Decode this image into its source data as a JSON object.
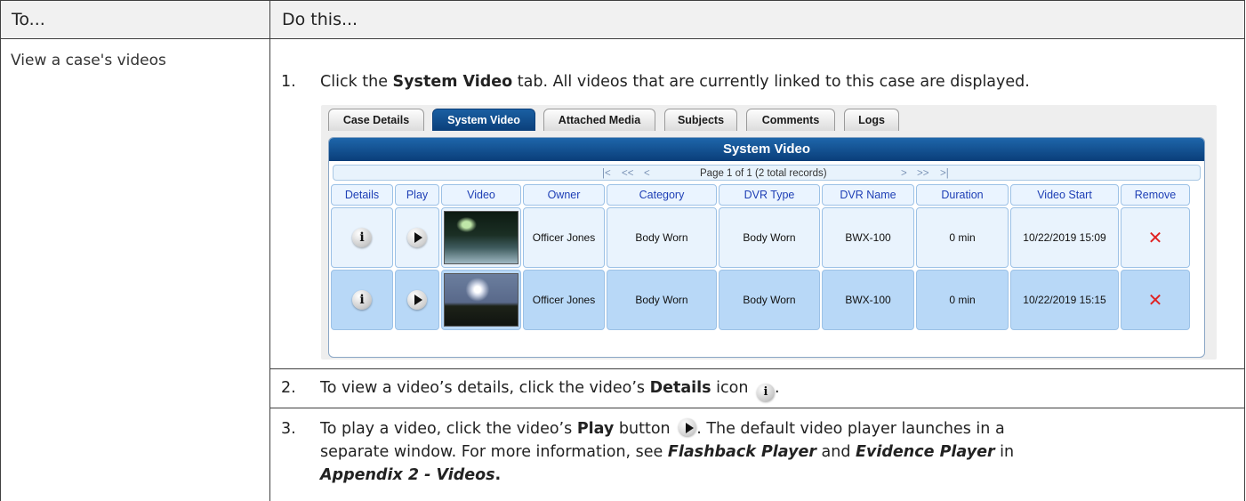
{
  "header": {
    "col1": "To...",
    "col2": "Do this..."
  },
  "row": {
    "task": "View a case's videos"
  },
  "steps": [
    {
      "num": "1.",
      "pre": "Click the ",
      "bold": "System Video",
      "post": " tab. All videos that are currently linked to this case are displayed."
    },
    {
      "num": "2.",
      "pre": "To view a video’s details, click the video’s ",
      "bold": "Details",
      "post": " icon ",
      "end": "."
    },
    {
      "num": "3.",
      "pre": "To play a video, click the video’s ",
      "bold": "Play",
      "post": " button ",
      "end": ". The default video player launches in a",
      "line2_pre": "separate window. For more information, see ",
      "line2_b1": "Flashback Player",
      "line2_mid": " and ",
      "line2_b2": "Evidence Player",
      "line2_post": " in",
      "line3_b": "Appendix 2 - Videos",
      "line3_post": "."
    }
  ],
  "app": {
    "tabs": [
      "Case Details",
      "System Video",
      "Attached Media",
      "Subjects",
      "Comments",
      "Logs"
    ],
    "active_tab": "System Video",
    "panel_title": "System Video",
    "pager": {
      "first": "|<",
      "prev_prev": "<<",
      "prev": "<",
      "text": "Page 1 of 1 (2 total records)",
      "next": ">",
      "next_next": ">>",
      "last": ">|"
    },
    "columns": [
      "Details",
      "Play",
      "Video",
      "Owner",
      "Category",
      "DVR Type",
      "DVR Name",
      "Duration",
      "Video Start",
      "Remove"
    ],
    "rows": [
      {
        "owner": "Officer Jones",
        "category": "Body Worn",
        "dvr_type": "Body Worn",
        "dvr_name": "BWX-100",
        "duration": "0 min",
        "video_start": "10/22/2019 15:09",
        "remove": "✕"
      },
      {
        "owner": "Officer Jones",
        "category": "Body Worn",
        "dvr_type": "Body Worn",
        "dvr_name": "BWX-100",
        "duration": "0 min",
        "video_start": "10/22/2019 15:15",
        "remove": "✕"
      }
    ],
    "icons": {
      "details": "info-icon",
      "play": "play-icon",
      "remove": "remove-x-icon"
    },
    "colors": {
      "tab_active": "#0b3f7a",
      "header_text": "#1e3fb5",
      "row_alt": "#b8d8f7",
      "remove": "#e02222"
    }
  }
}
